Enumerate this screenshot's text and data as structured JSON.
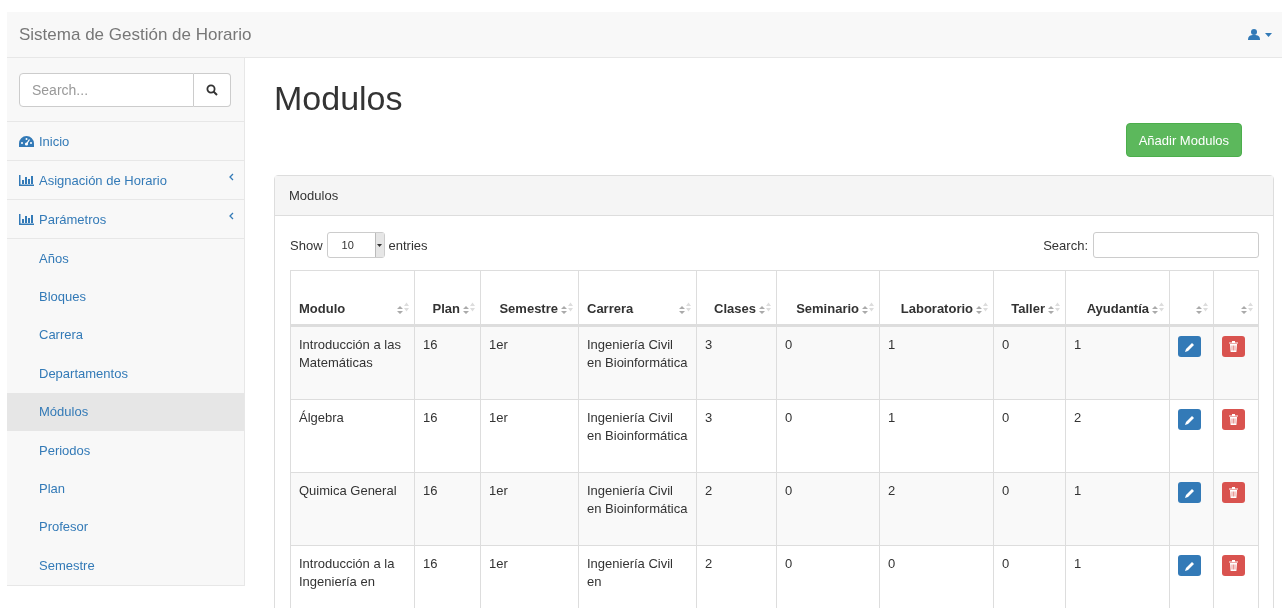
{
  "navbar": {
    "brand": "Sistema de Gestión de Horario"
  },
  "sidebar": {
    "search": {
      "placeholder": "Search..."
    },
    "items": [
      {
        "label": "Inicio",
        "kind": "home"
      },
      {
        "label": "Asignación de Horario",
        "kind": "group"
      },
      {
        "label": "Parámetros",
        "kind": "group",
        "children": [
          {
            "label": "Años",
            "selected": false
          },
          {
            "label": "Bloques",
            "selected": false
          },
          {
            "label": "Carrera",
            "selected": false
          },
          {
            "label": "Departamentos",
            "selected": false
          },
          {
            "label": "Módulos",
            "selected": true
          },
          {
            "label": "Periodos",
            "selected": false
          },
          {
            "label": "Plan",
            "selected": false
          },
          {
            "label": "Profesor",
            "selected": false
          },
          {
            "label": "Semestre",
            "selected": false
          }
        ]
      }
    ]
  },
  "page_title": "Modulos",
  "add_button": "Añadir Modulos",
  "panel": {
    "title": "Modulos",
    "length": {
      "show": "Show",
      "value": "10",
      "entries": "entries"
    },
    "search": {
      "label": "Search:"
    },
    "table": {
      "columns": [
        "Modulo",
        "Plan",
        "Semestre",
        "Carrera",
        "Clases",
        "Seminario",
        "Laboratorio",
        "Taller",
        "Ayudantía",
        "",
        ""
      ],
      "rows": [
        [
          "Introducción a las Matemáticas",
          "16",
          "1er",
          "Ingeniería Civil en Bioinformática",
          "3",
          "0",
          "1",
          "0",
          "1"
        ],
        [
          "Álgebra",
          "16",
          "1er",
          "Ingeniería Civil en Bioinformática",
          "3",
          "0",
          "1",
          "0",
          "2"
        ],
        [
          "Quimica General",
          "16",
          "1er",
          "Ingeniería Civil en Bioinformática",
          "2",
          "0",
          "2",
          "0",
          "1"
        ],
        [
          "Introducción a la Ingeniería en",
          "16",
          "1er",
          "Ingeniería Civil en",
          "2",
          "0",
          "0",
          "0",
          "1"
        ]
      ]
    }
  }
}
